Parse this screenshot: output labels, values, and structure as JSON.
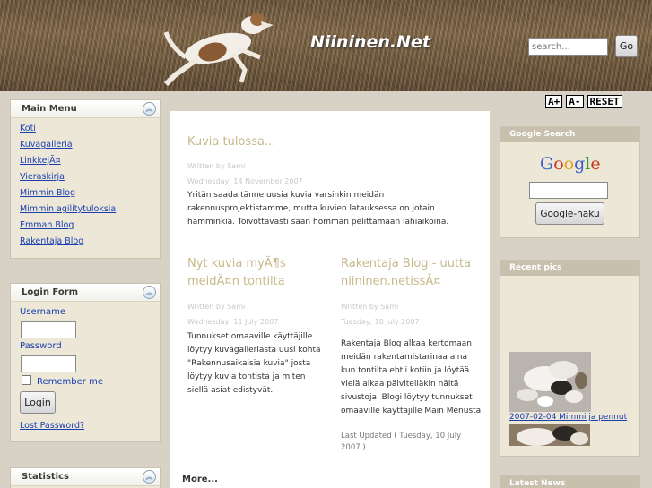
{
  "header": {
    "site_title": "Niininen.Net",
    "search_placeholder": "search...",
    "go_label": "Go"
  },
  "font_tools": {
    "increase": "A+",
    "decrease": "A-",
    "reset": "RESET"
  },
  "main_menu": {
    "title": "Main Menu",
    "items": [
      {
        "label": "Koti"
      },
      {
        "label": "Kuvagalleria"
      },
      {
        "label": "LinkkejÃ¤"
      },
      {
        "label": "Vieraskirja"
      },
      {
        "label": "Mimmin Blog"
      },
      {
        "label": "Mimmin agilitytuloksia"
      },
      {
        "label": "Emman Blog"
      },
      {
        "label": "Rakentaja Blog"
      }
    ]
  },
  "login_form": {
    "title": "Login Form",
    "username_label": "Username",
    "password_label": "Password",
    "remember_label": "Remember me",
    "login_button": "Login",
    "lost_password": "Lost Password?"
  },
  "statistics": {
    "title": "Statistics"
  },
  "articles": [
    {
      "title": "Kuvia tulossa...",
      "author": "Written by Sami",
      "date": "Wednesday, 14 November 2007",
      "body": "Yritän saada tänne uusia kuvia varsinkin meidän rakennusprojektistamme, mutta kuvien latauksessa on jotain hämminkiä. Toivottavasti saan homman pelittämään lähiaikoina."
    },
    {
      "title": "Nyt kuvia myÃ¶s meidÃ¤n tontilta",
      "author": "Written by Sami",
      "date": "Wednesday, 11 July 2007",
      "body": "Tunnukset omaaville käyttäjille löytyy kuvagalleriasta uusi kohta \"Rakennusaikaisia kuvia\" josta löytyy kuvia tontista ja miten siellä asiat edistyvät."
    },
    {
      "title": "Rakentaja Blog - uutta niininen.netissÃ¤",
      "author": "Written by Sami",
      "date": "Tuesday, 10 July 2007",
      "body": "Rakentaja Blog alkaa kertomaan meidän rakentamistarinaa aina kun tontilta ehtii kotiin ja löytää vielä aikaa päivitelläkin näitä sivustoja. Blogi löytyy tunnukset omaaville käyttäjille Main Menusta.",
      "updated": "Last Updated ( Tuesday, 10 July 2007 )"
    }
  ],
  "more_label": "More...",
  "google_search": {
    "title": "Google Search",
    "logo_letters": [
      "G",
      "o",
      "o",
      "g",
      "l",
      "e"
    ],
    "logo_colors": [
      "#3b5fc4",
      "#c8351e",
      "#e5a31a",
      "#3b5fc4",
      "#2f9a3a",
      "#c8351e"
    ],
    "button_label": "Google-haku"
  },
  "recent_pics": {
    "title": "Recent pics",
    "caption": "2007-02-04 Mimmi ja pennut"
  },
  "latest_news": {
    "title": "Latest News"
  }
}
